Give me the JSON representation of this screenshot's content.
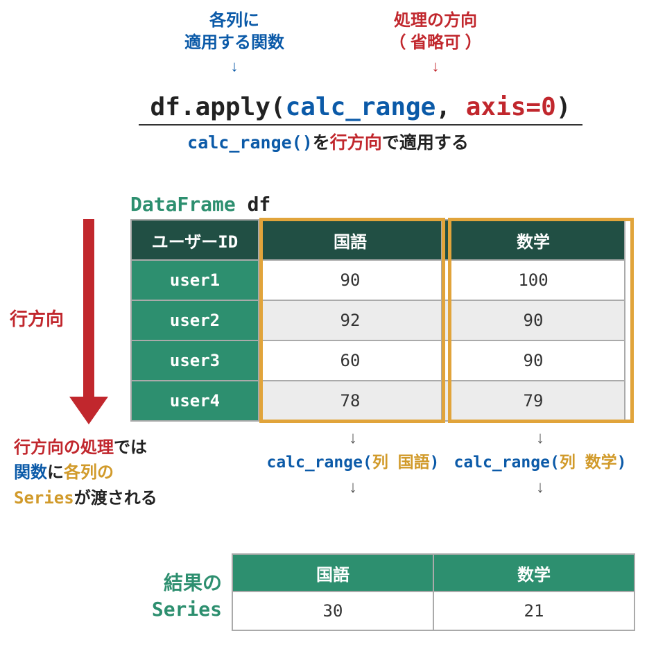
{
  "top": {
    "blue_line1": "各列に",
    "blue_line2": "適用する関数",
    "red_line1": "処理の方向",
    "red_line2": "（ 省略可 ）",
    "arrow": "↓"
  },
  "code": {
    "obj": "df",
    "dot_apply_open": ".apply(",
    "fn": "calc_range",
    "comma_sp": ", ",
    "axis": "axis=0",
    "close": ")"
  },
  "explain": {
    "p1": "calc_range()",
    "p2": "を",
    "p3": "行方向",
    "p4": "で適用する"
  },
  "df": {
    "type_label": "DataFrame",
    "name": " df",
    "index_header": "ユーザーID",
    "col1": "国語",
    "col2": "数学",
    "rows": [
      {
        "id": "user1",
        "a": "90",
        "b": "100"
      },
      {
        "id": "user2",
        "a": "92",
        "b": "90"
      },
      {
        "id": "user3",
        "a": "60",
        "b": "90"
      },
      {
        "id": "user4",
        "a": "78",
        "b": "79"
      }
    ]
  },
  "row_direction_label": "行方向",
  "left_explain": {
    "l1a": "行方向の処理",
    "l1b": "では",
    "l2a": "関数",
    "l2b": "に",
    "l2c": "各列の",
    "l3a": "Series",
    "l3b": "が渡される"
  },
  "calls": {
    "darr": "↓",
    "fn": "calc_range",
    "arg_prefix": "列 ",
    "arg1": "国語",
    "arg2": "数学"
  },
  "result": {
    "label_l1": "結果の",
    "label_l2": "Series",
    "h1": "国語",
    "h2": "数学",
    "v1": "30",
    "v2": "21"
  },
  "chart_data": {
    "type": "table",
    "title": "DataFrame df",
    "columns": [
      "ユーザーID",
      "国語",
      "数学"
    ],
    "rows": [
      [
        "user1",
        90,
        100
      ],
      [
        "user2",
        92,
        90
      ],
      [
        "user3",
        60,
        90
      ],
      [
        "user4",
        78,
        79
      ]
    ],
    "result": {
      "国語": 30,
      "数学": 21
    },
    "operation": "df.apply(calc_range, axis=0)"
  }
}
